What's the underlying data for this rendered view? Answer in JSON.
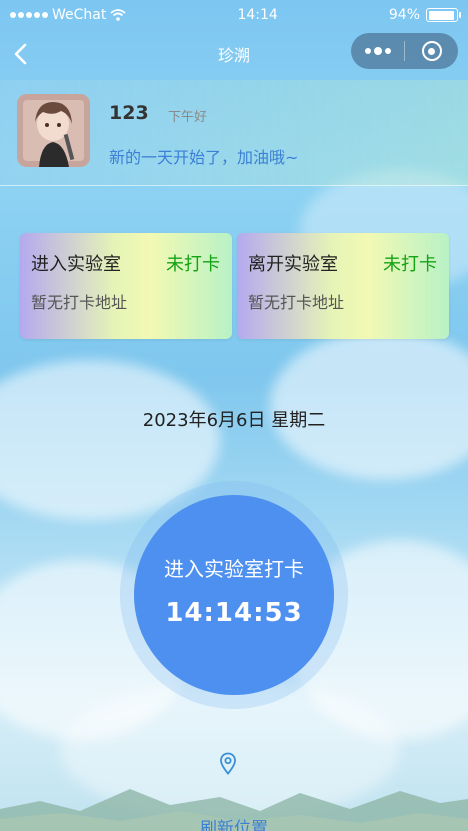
{
  "status_bar": {
    "carrier": "WeChat",
    "time": "14:14",
    "battery_text": "94%",
    "battery_level": 0.94
  },
  "nav": {
    "title": "珍溯",
    "back_icon": "chevron-left-icon",
    "more_icon": "more-dots-icon",
    "close_icon": "target-close-icon"
  },
  "profile": {
    "username": "123",
    "greeting": "下午好",
    "motto": "新的一天开始了，加油哦~"
  },
  "cards": [
    {
      "title": "进入实验室",
      "status": "未打卡",
      "address": "暂无打卡地址"
    },
    {
      "title": "离开实验室",
      "status": "未打卡",
      "address": "暂无打卡地址"
    }
  ],
  "date": "2023年6月6日 星期二",
  "punch": {
    "label": "进入实验室打卡",
    "time": "14:14:53"
  },
  "location": {
    "icon": "location-pin-icon",
    "refresh_label": "刷新位置"
  },
  "colors": {
    "accent_blue": "#4d90f0",
    "status_green": "#14a314",
    "link_blue": "#3b7fd6"
  }
}
